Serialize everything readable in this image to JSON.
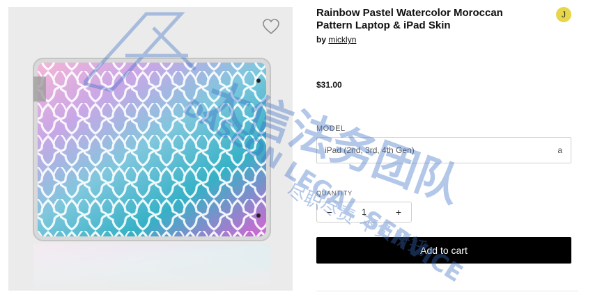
{
  "product": {
    "title": "Rainbow Pastel Watercolor Moroccan Pattern Laptop & iPad Skin",
    "by_label": "by",
    "artist": "micklyn",
    "price": "$31.00"
  },
  "user": {
    "avatar_initial": "J"
  },
  "options": {
    "model_label": "MODEL",
    "model_value": "iPad (2nd, 3rd, 4th Gen)",
    "model_chevron": "a",
    "quantity_label": "QUANTITY",
    "quantity_value": "1",
    "minus_symbol": "−",
    "plus_symbol": "+"
  },
  "actions": {
    "add_to_cart": "Add to cart"
  },
  "icons": {
    "favorite": "heart-outline-icon",
    "decrement": "minus-icon",
    "increment": "plus-icon",
    "dropdown": "chevron-down-icon"
  },
  "watermark": {
    "chinese_text": "大信法务团队",
    "english_text": "DASEON LEGAL SERVICE",
    "subtitle_text": "尽职尽责 不负所托"
  },
  "colors": {
    "avatar_bg": "#e8d64a",
    "button_bg": "#000000",
    "panel_bg": "#ebebeb",
    "watermark": "#3b6fc4"
  }
}
